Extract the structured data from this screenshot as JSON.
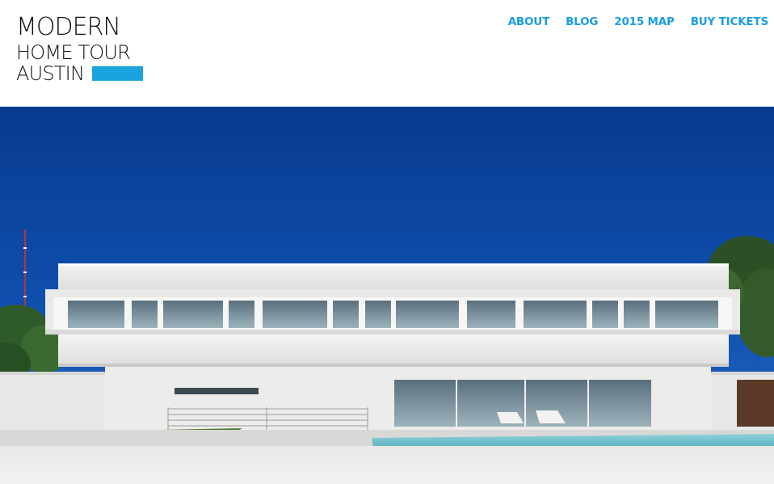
{
  "logo": {
    "line1": "MODERN",
    "line2": "HOME TOUR",
    "line3": "AUSTIN",
    "accent_color": "#1ba3e0"
  },
  "nav": {
    "items": [
      {
        "label": "ABOUT"
      },
      {
        "label": "BLOG"
      },
      {
        "label": "2015 MAP"
      },
      {
        "label": "BUY TICKETS"
      }
    ],
    "link_color": "#1a9ee0"
  },
  "hero": {
    "icon": "modern-house-photo",
    "sky_color": "#0d3f96"
  }
}
